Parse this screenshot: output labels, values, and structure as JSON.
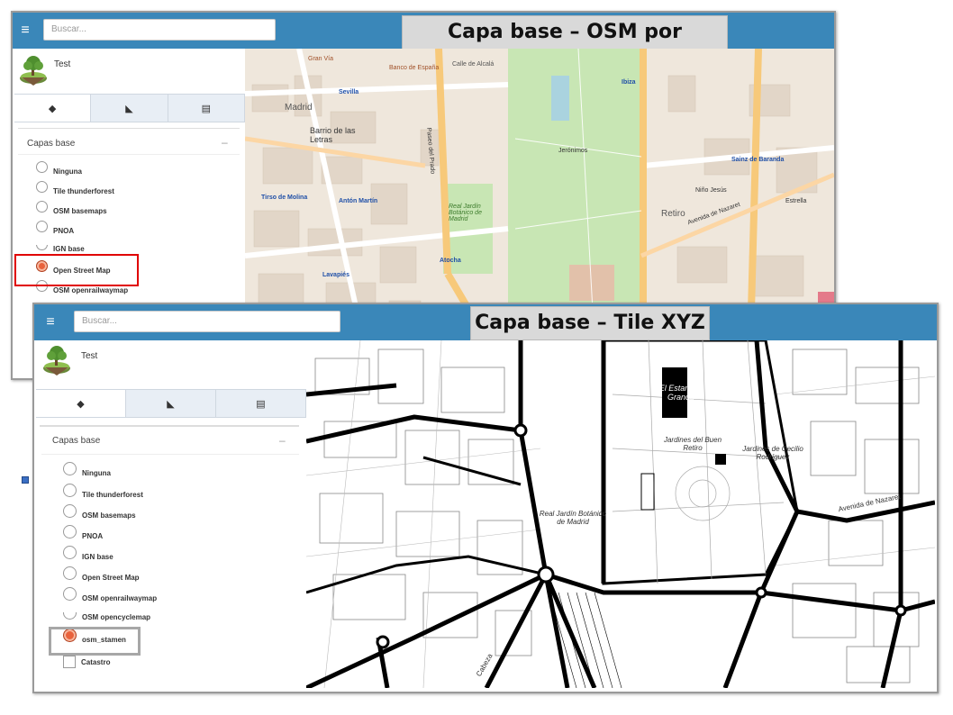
{
  "osm_panel": {
    "search_placeholder": "Buscar...",
    "caption": "Capa base – OSM por defecto",
    "app_name": "Test",
    "section_title": "Capas base",
    "collapse": "–",
    "layers": [
      {
        "label": "Ninguna",
        "checked": false
      },
      {
        "label": "Tile thunderforest",
        "checked": false
      },
      {
        "label": "OSM basemaps",
        "checked": false
      },
      {
        "label": "PNOA",
        "checked": false
      },
      {
        "label": "IGN base",
        "checked": false
      },
      {
        "label": "Open Street Map",
        "checked": true
      },
      {
        "label": "OSM openrailwaymap",
        "checked": false
      }
    ],
    "map_labels": {
      "madrid": "Madrid",
      "barrio_letras": "Barrio de las Letras",
      "sevilla": "Sevilla",
      "banco": "Banco de España",
      "ibiza": "Ibiza",
      "sainz": "Sainz de Baranda",
      "tirso": "Tirso de Molina",
      "anton": "Antón Martín",
      "atocha": "Atocha",
      "lavapies": "Lavapiés",
      "retiro": "Retiro",
      "jardin": "Real Jardín Botánico de Madrid",
      "jeronimos": "Jerónimos",
      "nino_jesus": "Niño Jesús",
      "estrella": "Estrella",
      "avenida": "Avenida de Nazaret",
      "paseo_prado": "Paseo del Prado",
      "gran_via": "Gran Vía",
      "alcala": "Calle de Alcalá"
    }
  },
  "xyz_panel": {
    "search_placeholder": "Buscar...",
    "caption": "Capa base – Tile XYZ",
    "app_name": "Test",
    "section_title": "Capas base",
    "collapse": "–",
    "layers": [
      {
        "label": "Ninguna",
        "checked": false
      },
      {
        "label": "Tile thunderforest",
        "checked": false
      },
      {
        "label": "OSM basemaps",
        "checked": false
      },
      {
        "label": "PNOA",
        "checked": false
      },
      {
        "label": "IGN base",
        "checked": false
      },
      {
        "label": "Open Street Map",
        "checked": false
      },
      {
        "label": "OSM openrailwaymap",
        "checked": false
      },
      {
        "label": "OSM opencyclemap",
        "checked": false
      },
      {
        "label": "osm_stamen",
        "checked": true
      },
      {
        "label": "Catastro",
        "checked": false
      }
    ],
    "map_labels": {
      "estanque": "El Estanque Grande",
      "jardines_buen_retiro": "Jardines del Buen Retiro",
      "jardines_cecilio": "Jardines de Cecilio Rodríguez",
      "jardin_botanico": "Real Jardín Botánico de Madrid",
      "avenida": "Avenida de Nazaret",
      "cabeza": "Cabeza"
    }
  },
  "colors": {
    "topbar": "#3a87b9",
    "highlight_red": "#e00000",
    "highlight_grey": "#a7a7a7",
    "radio_checked": "#e9623c"
  }
}
